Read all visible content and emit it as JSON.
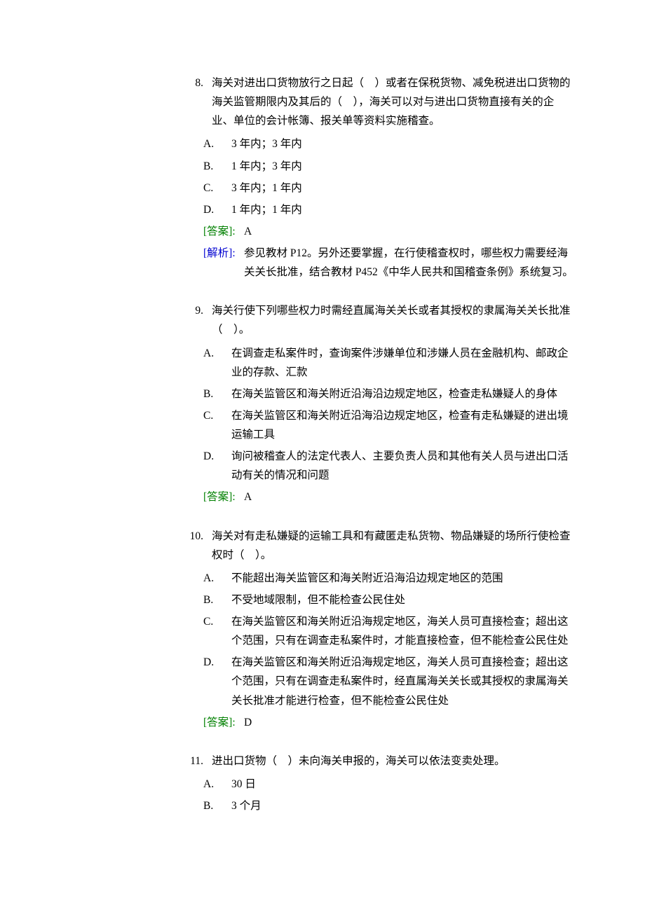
{
  "questions": [
    {
      "num": "8.",
      "stem": "海关对进出口货物放行之日起（　）或者在保税货物、减免税进出口货物的海关监管期限内及其后的（　），海关可以对与进出口货物直接有关的企业、单位的会计帐簿、报关单等资料实施稽查。",
      "options": [
        {
          "letter": "A.",
          "text": "3 年内；3 年内"
        },
        {
          "letter": "B.",
          "text": "1 年内；3 年内"
        },
        {
          "letter": "C.",
          "text": "3 年内；1 年内"
        },
        {
          "letter": "D.",
          "text": "1 年内；1 年内"
        }
      ],
      "answer_label": "[答案]:",
      "answer": "A",
      "explain_label": "[解析]:",
      "explain": "参见教材 P12。另外还要掌握，在行使稽查权时，哪些权力需要经海关关长批准，结合教材 P452《中华人民共和国稽查条例》系统复习。"
    },
    {
      "num": "9.",
      "stem": "海关行使下列哪些权力时需经直属海关关长或者其授权的隶属海关关长批准（　）。",
      "options": [
        {
          "letter": "A.",
          "text": "在调查走私案件时，查询案件涉嫌单位和涉嫌人员在金融机构、邮政企业的存款、汇款"
        },
        {
          "letter": "B.",
          "text": "在海关监管区和海关附近沿海沿边规定地区，检查走私嫌疑人的身体"
        },
        {
          "letter": "C.",
          "text": "在海关监管区和海关附近沿海沿边规定地区，检查有走私嫌疑的进出境运输工具"
        },
        {
          "letter": "D.",
          "text": "询问被稽查人的法定代表人、主要负责人员和其他有关人员与进出口活动有关的情况和问题"
        }
      ],
      "answer_label": "[答案]:",
      "answer": "A"
    },
    {
      "num": "10.",
      "stem": "海关对有走私嫌疑的运输工具和有藏匿走私货物、物品嫌疑的场所行使检查权时（　）。",
      "options": [
        {
          "letter": "A.",
          "text": "不能超出海关监管区和海关附近沿海沿边规定地区的范围"
        },
        {
          "letter": "B.",
          "text": "不受地域限制，但不能检查公民住处"
        },
        {
          "letter": "C.",
          "text": "在海关监管区和海关附近沿海规定地区，海关人员可直接检查；超出这个范围，只有在调查走私案件时，才能直接检查，但不能检查公民住处"
        },
        {
          "letter": "D.",
          "text": "在海关监管区和海关附近沿海规定地区，海关人员可直接检查；超出这个范围，只有在调查走私案件时，经直属海关关长或其授权的隶属海关关长批准才能进行检查，但不能检查公民住处"
        }
      ],
      "answer_label": "[答案]:",
      "answer": "D"
    },
    {
      "num": "11.",
      "stem": "进出口货物（　）未向海关申报的，海关可以依法变卖处理。",
      "options": [
        {
          "letter": "A.",
          "text": "30 日"
        },
        {
          "letter": "B.",
          "text": "3 个月"
        }
      ]
    }
  ]
}
